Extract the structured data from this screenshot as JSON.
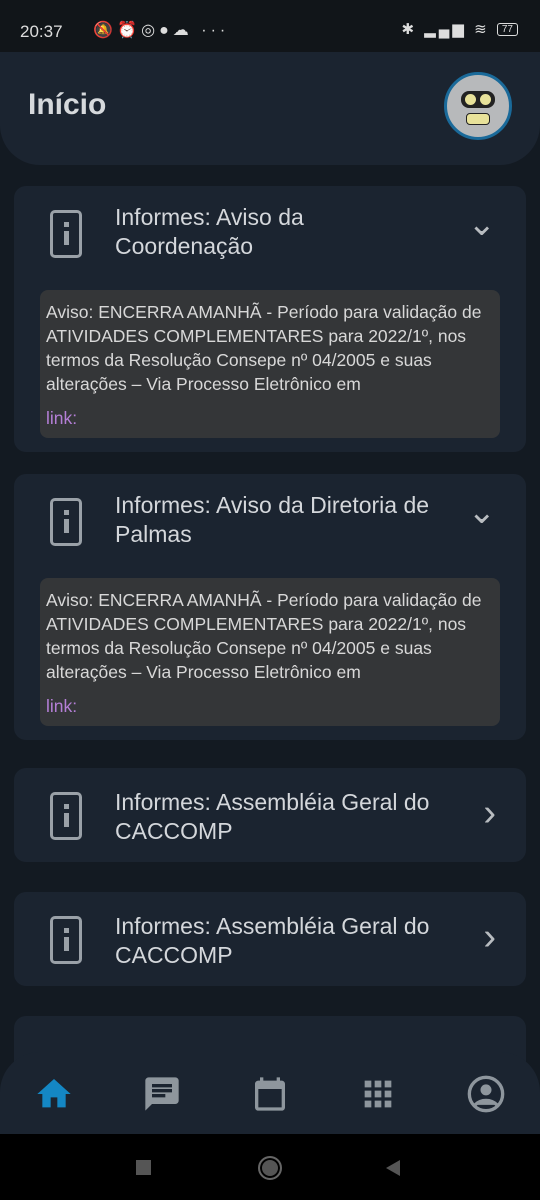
{
  "status_bar": {
    "time": "20:37",
    "battery": "77"
  },
  "header": {
    "title": "Início"
  },
  "cards": [
    {
      "title": "Informes: Aviso da Coordenação",
      "expanded": true,
      "body": "Aviso: ENCERRA AMANHÃ - Período para validação de ATIVIDADES COMPLEMENTARES para 2022/1º, nos termos da Resolução Consepe nº 04/2005 e suas alterações – Via Processo Eletrônico em",
      "link": "link:"
    },
    {
      "title": "Informes: Aviso da Diretoria de Palmas",
      "expanded": true,
      "body": "Aviso: ENCERRA AMANHÃ - Período para validação de ATIVIDADES COMPLEMENTARES para 2022/1º, nos termos da Resolução Consepe nº 04/2005 e suas alterações – Via Processo Eletrônico em",
      "link": "link:"
    },
    {
      "title": "Informes: Assembléia Geral do CACCOMP",
      "expanded": false
    },
    {
      "title": "Informes: Assembléia Geral do CACCOMP",
      "expanded": false
    }
  ],
  "colors": {
    "accent": "#1487c4",
    "card": "#1b2430",
    "background": "#131a22"
  }
}
